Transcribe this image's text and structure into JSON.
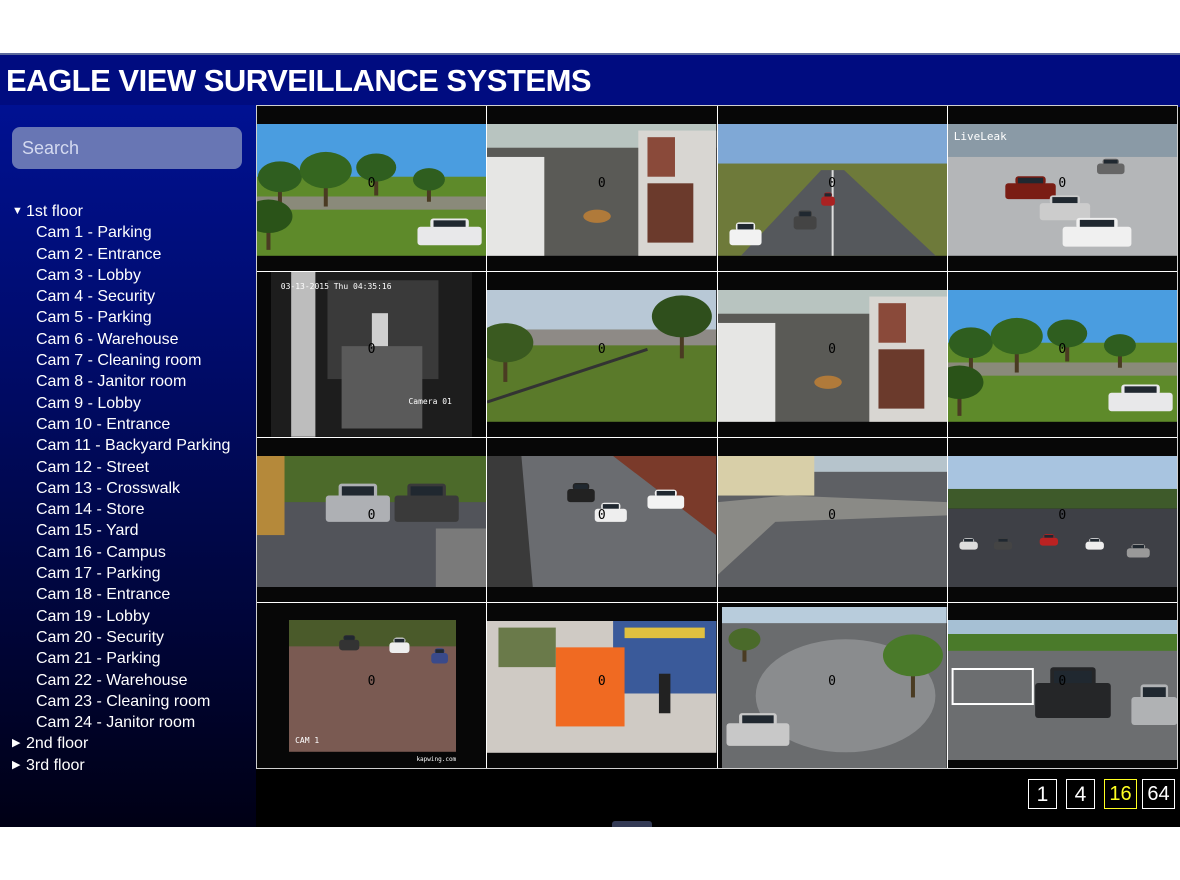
{
  "app": {
    "title": "EAGLE VIEW SURVEILLANCE SYSTEMS"
  },
  "search": {
    "placeholder": "Search",
    "value": ""
  },
  "tree": {
    "floors": [
      {
        "label": "1st floor",
        "expanded": true,
        "cameras": [
          "Cam 1 - Parking",
          "Cam 2 - Entrance",
          "Cam 3 - Lobby",
          "Cam 4 - Security",
          "Cam 5 - Parking",
          "Cam 6 - Warehouse",
          "Cam 7 - Cleaning room",
          "Cam 8 - Janitor room",
          "Cam 9 - Lobby",
          "Cam 10 - Entrance",
          "Cam 11 - Backyard Parking",
          "Cam 12 - Street",
          "Cam 13 - Crosswalk",
          "Cam 14 - Store",
          "Cam 15 - Yard",
          "Cam 16 - Campus",
          "Cam 17 - Parking",
          "Cam 18 - Entrance",
          "Cam 19 - Lobby",
          "Cam 20 - Security",
          "Cam 21 - Parking",
          "Cam 22 - Warehouse",
          "Cam 23 - Cleaning room",
          "Cam 24 - Janitor room"
        ]
      },
      {
        "label": "2nd floor",
        "expanded": false,
        "cameras": []
      },
      {
        "label": "3rd floor",
        "expanded": false,
        "cameras": []
      }
    ]
  },
  "grid": {
    "layout": 16,
    "feeds": [
      {
        "scene": "park",
        "overlay": "0",
        "caption": ""
      },
      {
        "scene": "gate",
        "overlay": "0",
        "caption": ""
      },
      {
        "scene": "highway",
        "overlay": "0",
        "caption": ""
      },
      {
        "scene": "parking-lot",
        "overlay": "0",
        "caption": "LiveLeak"
      },
      {
        "scene": "night-door",
        "overlay": "0",
        "caption": "Camera 01",
        "timestamp": "03-13-2015 Thu 04:35:16"
      },
      {
        "scene": "yard",
        "overlay": "0",
        "caption": ""
      },
      {
        "scene": "gate",
        "overlay": "0",
        "caption": ""
      },
      {
        "scene": "park",
        "overlay": "0",
        "caption": ""
      },
      {
        "scene": "driveway",
        "overlay": "0",
        "caption": ""
      },
      {
        "scene": "street",
        "overlay": "0",
        "caption": ""
      },
      {
        "scene": "corner",
        "overlay": "0",
        "caption": ""
      },
      {
        "scene": "campus",
        "overlay": "0",
        "caption": ""
      },
      {
        "scene": "brick-lot",
        "overlay": "0",
        "caption": "CAM 1",
        "footer": "kapwing.com"
      },
      {
        "scene": "store",
        "overlay": "0",
        "caption": ""
      },
      {
        "scene": "roundabout",
        "overlay": "0",
        "caption": ""
      },
      {
        "scene": "lot-car",
        "overlay": "0",
        "caption": ""
      }
    ]
  },
  "layout_buttons": [
    {
      "label": "1",
      "active": false
    },
    {
      "label": "4",
      "active": false
    },
    {
      "label": "16",
      "active": true
    },
    {
      "label": "64",
      "active": false
    }
  ],
  "colors": {
    "header_bg": "#000c80",
    "active_layout": "#ffff22",
    "search_bg": "#6876b4"
  }
}
